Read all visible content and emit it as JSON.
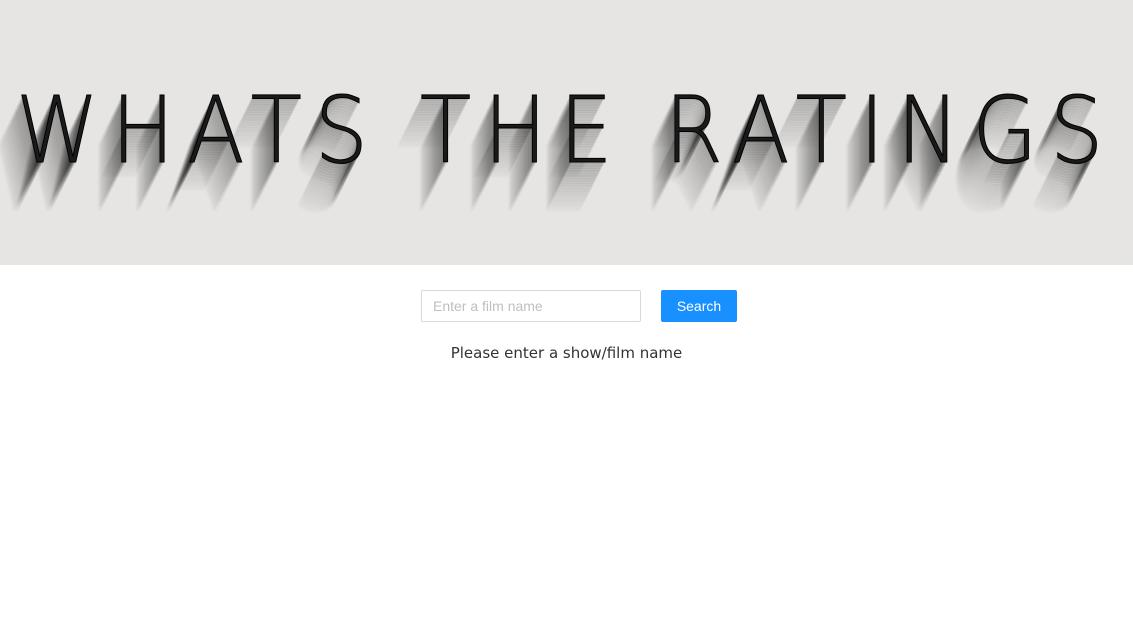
{
  "header": {
    "title": "WHATS THE RATINGS"
  },
  "search": {
    "placeholder": "Enter a film name",
    "value": "",
    "button_label": "Search"
  },
  "status": {
    "message": "Please enter a show/film name"
  },
  "colors": {
    "hero_background": "#e6e5e3",
    "title_text": "#1a1a1a",
    "button_primary": "#1890ff"
  }
}
